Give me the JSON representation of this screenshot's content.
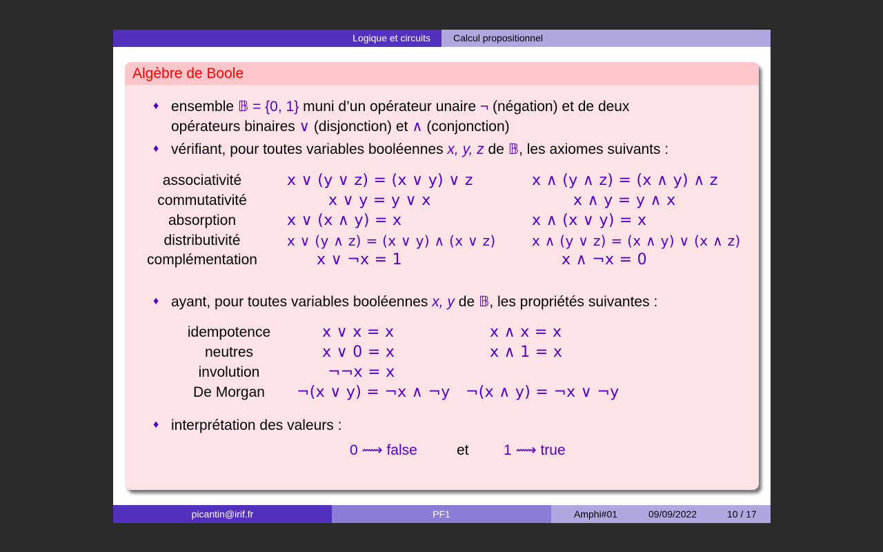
{
  "header": {
    "section": "Logique et circuits",
    "subsection": "Calcul propositionnel"
  },
  "block": {
    "title": "Algèbre de Boole"
  },
  "bullets": {
    "b1_pre": "ensemble ",
    "b1_set": "𝔹 = {0, 1}",
    "b1_mid": " muni d’un opérateur unaire ",
    "b1_neg": "¬",
    "b1_post": " (négation) et de deux",
    "b1_line2a": "opérateurs binaires ",
    "b1_or": "∨",
    "b1_line2b": " (disjonction) et ",
    "b1_and": "∧",
    "b1_line2c": " (conjonction)",
    "b2_pre": "vérifiant, pour toutes variables booléennes ",
    "b2_vars": "x, y, z",
    "b2_de": " de ",
    "b2_B": "𝔹",
    "b2_post": ", les axiomes suivants :",
    "b3_pre": "ayant, pour toutes variables booléennes ",
    "b3_vars": "x, y",
    "b3_de": " de ",
    "b3_B": "𝔹",
    "b3_post": ", les propriétés suivantes :",
    "b4": "interprétation des valeurs :"
  },
  "axioms": [
    {
      "name": "associativité",
      "left": "x ∨ (y ∨ z) = (x ∨ y) ∨ z",
      "right": "x ∧ (y ∧ z) = (x ∧ y) ∧ z"
    },
    {
      "name": "commutativité",
      "left": "x ∨ y = y ∨ x",
      "right": "x ∧ y = y ∧ x"
    },
    {
      "name": "absorption",
      "left": "x ∨ (x ∧ y) = x",
      "right": "x ∧ (x ∨ y) = x"
    },
    {
      "name": "distributivité",
      "left": "x ∨ (y ∧ z) = (x ∨ y) ∧ (x ∨ z)",
      "right": "x ∧ (y ∨ z) = (x ∧ y) ∨ (x ∧ z)"
    },
    {
      "name": "complémentation",
      "left": "x ∨ ¬x = 1",
      "right": "x ∧ ¬x = 0"
    }
  ],
  "properties": [
    {
      "name": "idempotence",
      "left": "x ∨ x = x",
      "right": "x ∧ x = x"
    },
    {
      "name": "neutres",
      "left": "x ∨ 0 = x",
      "right": "x ∧ 1 = x"
    },
    {
      "name": "involution",
      "left": "¬¬x = x",
      "right": ""
    },
    {
      "name": "De Morgan",
      "left": "¬(x ∨ y) = ¬x ∧ ¬y",
      "right": "¬(x ∧ y) = ¬x ∨ ¬y"
    }
  ],
  "interpretation": {
    "zero": "0 ⟿ false",
    "et": "et",
    "one": "1 ⟿ true"
  },
  "footer": {
    "author": "picantin@irif.fr",
    "course": "PF1",
    "session": "Amphi#01",
    "date": "09/09/2022",
    "page": "10 / 17"
  },
  "colors": {
    "math": "#5200c8",
    "title": "#ff0000",
    "dark": "#5231bf"
  }
}
